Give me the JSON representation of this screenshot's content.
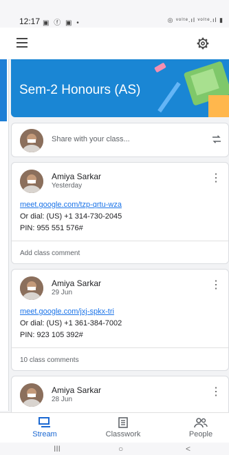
{
  "status_bar": {
    "time": "12:17",
    "left_icons": "▣ ⓕ ▣ •",
    "right_icons": "◎ ᵛᵒˡᵗᵉ.ıl ᵛᵒˡᵗᵉ.ıl ▮"
  },
  "banner": {
    "title": "Sem-2 Honours (AS)"
  },
  "share": {
    "placeholder": "Share with your class..."
  },
  "posts": [
    {
      "author": "Amiya Sarkar",
      "date": "Yesterday",
      "link": "meet.google.com/tzp-qrtu-wza",
      "dial": "Or dial: (US) +1 314-730-2045",
      "pin": "PIN: 955 551 576#",
      "comments": "Add class comment"
    },
    {
      "author": "Amiya Sarkar",
      "date": "29 Jun",
      "link": "meet.google.com/jxj-spkx-tri",
      "dial": "Or dial: (US) +1 361-384-7002",
      "pin": "PIN: 923 105 392#",
      "comments": "10 class comments"
    },
    {
      "author": "Amiya Sarkar",
      "date": "28 Jun"
    }
  ],
  "nav": {
    "stream": "Stream",
    "classwork": "Classwork",
    "people": "People"
  },
  "sys_nav": {
    "recent": "III",
    "home": "○",
    "back": "<"
  },
  "colors": {
    "accent": "#1967d2",
    "banner": "#1a86d4",
    "link": "#1a73e8"
  }
}
